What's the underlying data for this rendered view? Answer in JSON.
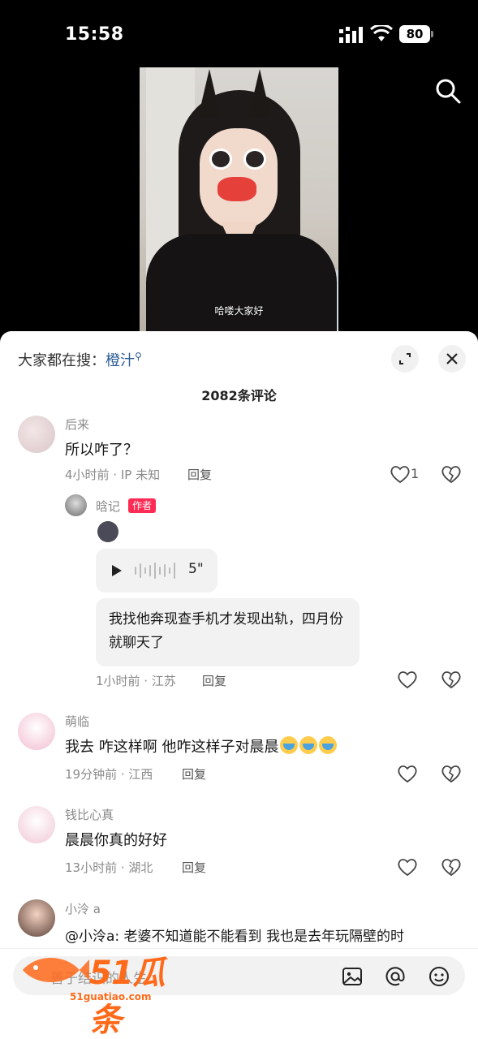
{
  "status_bar": {
    "time": "15:58",
    "battery": "80"
  },
  "video": {
    "subtitle": "哈喽大家好"
  },
  "sheet": {
    "search_prefix": "大家都在搜：",
    "search_keyword": "橙汁",
    "comment_count": "2082条评论"
  },
  "comments": [
    {
      "name": "后来",
      "text": "所以咋了？",
      "meta": "4小时前 · IP 未知",
      "reply": "回复",
      "likes": "1"
    },
    {
      "name": "晗记",
      "badge": "作者",
      "voice_duration": "5\"",
      "text": "我找他奔现查手机才发现出轨，四月份就聊天了",
      "meta": "1小时前 · 江苏",
      "reply": "回复"
    },
    {
      "name": "萌临",
      "text": "我去 咋这样啊 他咋这样子对晨晨",
      "meta": "19分钟前 · 江西",
      "reply": "回复"
    },
    {
      "name": "钱比心真",
      "text": "晨晨你真的好好",
      "meta": "13小时前 · 湖北",
      "reply": "回复"
    },
    {
      "name": "小泠 a",
      "text": "@小泠a: 老婆不知道能不能看到  我也是去年玩隔壁的时"
    }
  ],
  "input": {
    "placeholder": "善于结识的人生"
  },
  "watermark": {
    "logo": "51瓜条",
    "url": "51guatiao.com"
  },
  "colors": {
    "accent_red": "#fe2c55",
    "keyword_blue": "#2b5a95",
    "watermark_orange": "#ff6a1a"
  }
}
